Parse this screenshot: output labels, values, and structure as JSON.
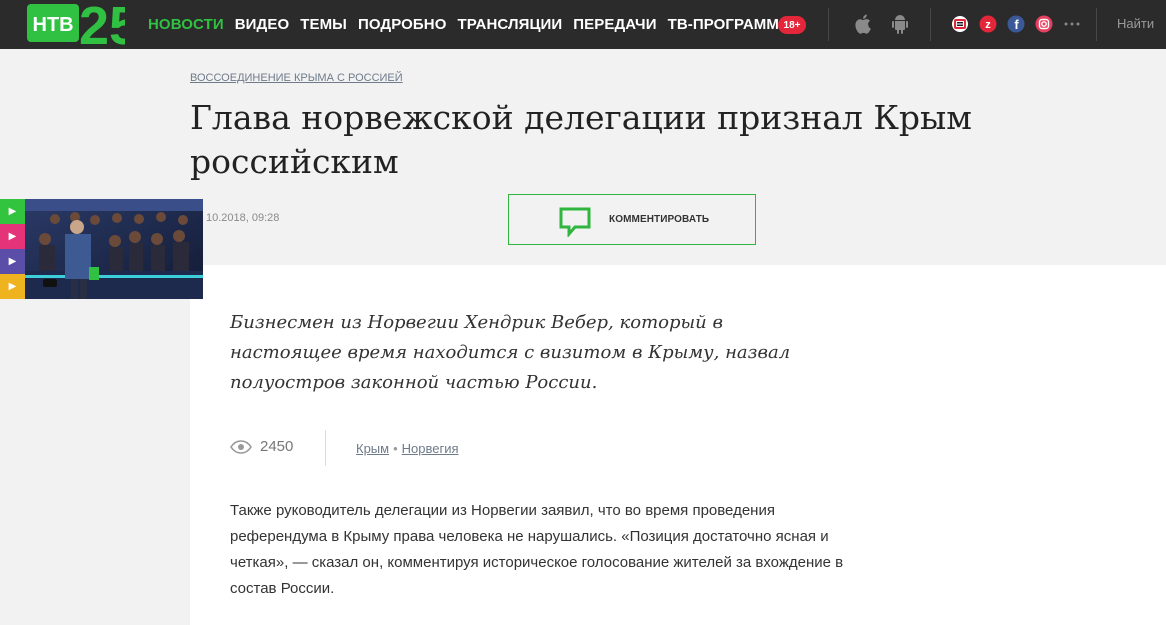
{
  "header": {
    "logo_text": "НТВ 25",
    "nav": [
      "НОВОСТИ",
      "ВИДЕО",
      "ТЕМЫ",
      "ПОДРОБНО",
      "ТРАНСЛЯЦИИ",
      "ПЕРЕДАЧИ",
      "ТВ-ПРОГРАММА"
    ],
    "age_badge": "18+",
    "search_label": "Найти",
    "icons": [
      "apple-icon",
      "android-icon",
      "ok-icon",
      "zen-icon",
      "facebook-icon",
      "instagram-icon",
      "more-icon"
    ]
  },
  "article": {
    "rubric": "ВОССОЕДИНЕНИЕ КРЫМА С РОССИЕЙ",
    "title": "Глава норвежской делегации признал Крым российским",
    "date": "10.2018, 09:28",
    "comment_label": "КОММЕНТИРОВАТЬ",
    "lead": "Бизнесмен из Норвегии Хендрик Вебер, который в настоящее время находится с визитом в Крыму, назвал полуостров законной частью России.",
    "views": "2450",
    "tags": [
      "Крым",
      "Норвегия"
    ],
    "tag_separator": "•",
    "body": "Также руководитель делегации из Норвегии заявил, что во время проведения референдума в Крыму права человека не нарушались. «Позиция достаточно ясная и четкая», — сказал он, комментируя историческое голосование жителей за вхождение в состав России."
  },
  "colors": {
    "accent_green": "#30c142",
    "topbar_bg": "#2b2b2b",
    "badge_red": "#e3263a",
    "video_btns": [
      "#33c43f",
      "#e5337a",
      "#5b4ea8",
      "#f0b320"
    ]
  }
}
